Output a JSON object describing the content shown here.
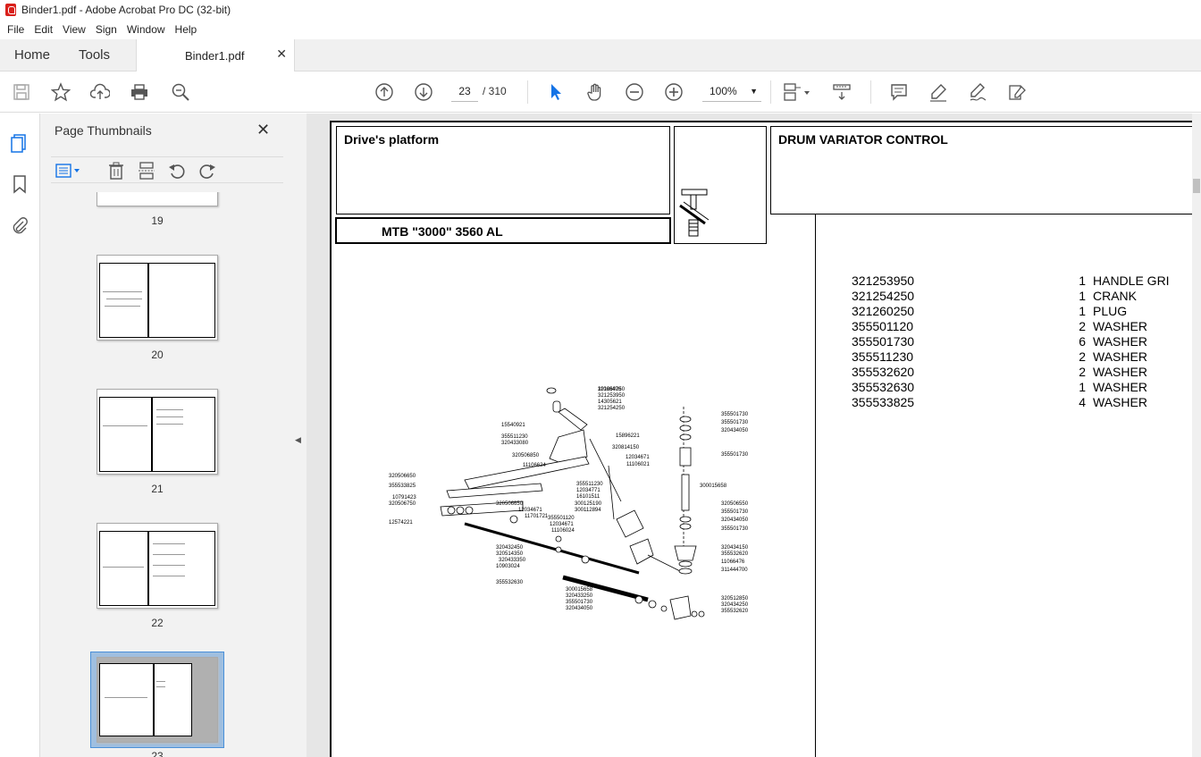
{
  "window": {
    "title": "Binder1.pdf - Adobe Acrobat Pro DC (32-bit)"
  },
  "menu": [
    "File",
    "Edit",
    "View",
    "Sign",
    "Window",
    "Help"
  ],
  "tabs": {
    "home": "Home",
    "tools": "Tools",
    "document": "Binder1.pdf"
  },
  "toolbar": {
    "current_page": "23",
    "total_pages": "/ 310",
    "zoom": "100%"
  },
  "panel": {
    "title": "Page Thumbnails",
    "thumbnails": [
      {
        "label": "19"
      },
      {
        "label": "20"
      },
      {
        "label": "21"
      },
      {
        "label": "22"
      },
      {
        "label": "23",
        "selected": true
      }
    ]
  },
  "document": {
    "header_left": "Drive's platform",
    "model": "MTB \"3000\" 3560 AL",
    "header_right": "DRUM VARIATOR CONTROL",
    "parts": [
      {
        "no": "321253950",
        "qty": "1",
        "desc": "HANDLE GRI"
      },
      {
        "no": "321254250",
        "qty": "1",
        "desc": "CRANK"
      },
      {
        "no": "321260250",
        "qty": "1",
        "desc": "PLUG"
      },
      {
        "no": "355501120",
        "qty": "2",
        "desc": "WASHER"
      },
      {
        "no": "355501730",
        "qty": "6",
        "desc": "WASHER"
      },
      {
        "no": "355511230",
        "qty": "2",
        "desc": "WASHER"
      },
      {
        "no": "355532620",
        "qty": "2",
        "desc": "WASHER"
      },
      {
        "no": "355532630",
        "qty": "1",
        "desc": "WASHER"
      },
      {
        "no": "355533825",
        "qty": "4",
        "desc": "WASHER"
      }
    ],
    "callouts": [
      "321260250",
      "321253950",
      "14305621",
      "321254250",
      "15540921",
      "355511230",
      "320433080",
      "15896221",
      "320814150",
      "320506850",
      "11106624",
      "12034671",
      "11106021",
      "320506650",
      "355533825",
      "355511230",
      "12034771",
      "16101511",
      "10791423",
      "320506750",
      "300125190",
      "300112894",
      "320506650",
      "12034671",
      "11701721",
      "355501120",
      "12034671",
      "11106024",
      "12574221",
      "320432450",
      "320514350",
      "320433350",
      "10903024",
      "355532630",
      "300015658",
      "320433250",
      "355501730",
      "320434050",
      "355501730",
      "355501730",
      "320434050",
      "355501730",
      "300015658",
      "320506550",
      "355501730",
      "320434050",
      "355501730",
      "320434150",
      "355532620",
      "11066476",
      "311444700",
      "320512850",
      "320434250",
      "355532620",
      "11066476"
    ]
  },
  "colors": {
    "accent": "#1473e6",
    "logo": "#d9201b"
  }
}
